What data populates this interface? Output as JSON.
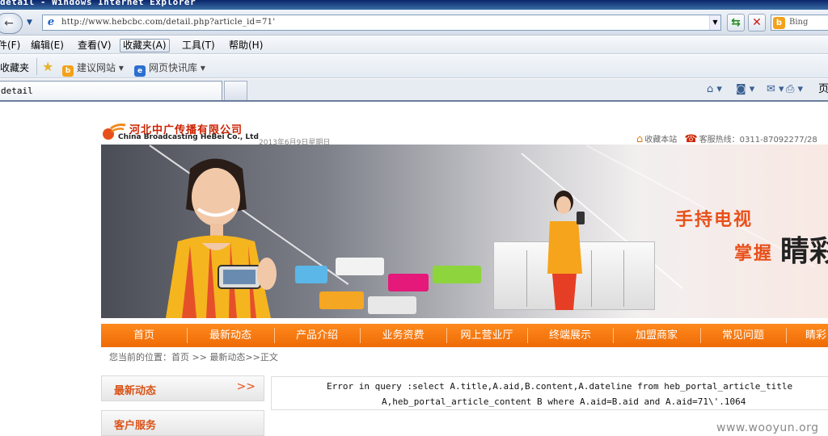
{
  "window": {
    "title": "detail - Windows Internet Explorer"
  },
  "address": {
    "url": "http://www.hebcbc.com/detail.php?article_id=71'"
  },
  "search": {
    "placeholder": "Bing"
  },
  "menu": {
    "items": [
      "件(F)",
      "编辑(E)",
      "查看(V)",
      "收藏夹(A)",
      "工具(T)",
      "帮助(H)"
    ]
  },
  "favorites": {
    "label": "收藏夹",
    "links": [
      "建议网站 ▾",
      "网页快讯库 ▾"
    ]
  },
  "tab": {
    "title": "detail",
    "page_menu": "页"
  },
  "site": {
    "company_cn": "河北中广传播有限公司",
    "company_en": "China Broadcasting HeBei Co., Ltd",
    "date": "2013年6月9日星期日",
    "bookmark_link": "收藏本站",
    "hotline": "客服热线：0311-87092277/28"
  },
  "banner": {
    "slogan_line1": "手持电视",
    "slogan_line2": "掌握",
    "slogan_big": "睛彩"
  },
  "nav": {
    "items": [
      "首页",
      "最新动态",
      "产品介绍",
      "业务资费",
      "网上营业厅",
      "终端展示",
      "加盟商家",
      "常见问题",
      "睛彩"
    ]
  },
  "breadcrumb": "您当前的位置：首页 >> 最新动态>>正文",
  "sidebar": {
    "news_title": "最新动态",
    "news_arrow": ">>",
    "service_title": "客户服务"
  },
  "error": {
    "line1": "Error in query :select A.title,A.aid,B.content,A.dateline from heb_portal_article_title",
    "line2": "A,heb_portal_article_content B where A.aid=B.aid and A.aid=71\\'.1064"
  },
  "watermark": "www.wooyun.org",
  "colors": {
    "accent": "#ee6a05",
    "link_text": "#d9541a",
    "chrome": "#e6ebf2"
  }
}
